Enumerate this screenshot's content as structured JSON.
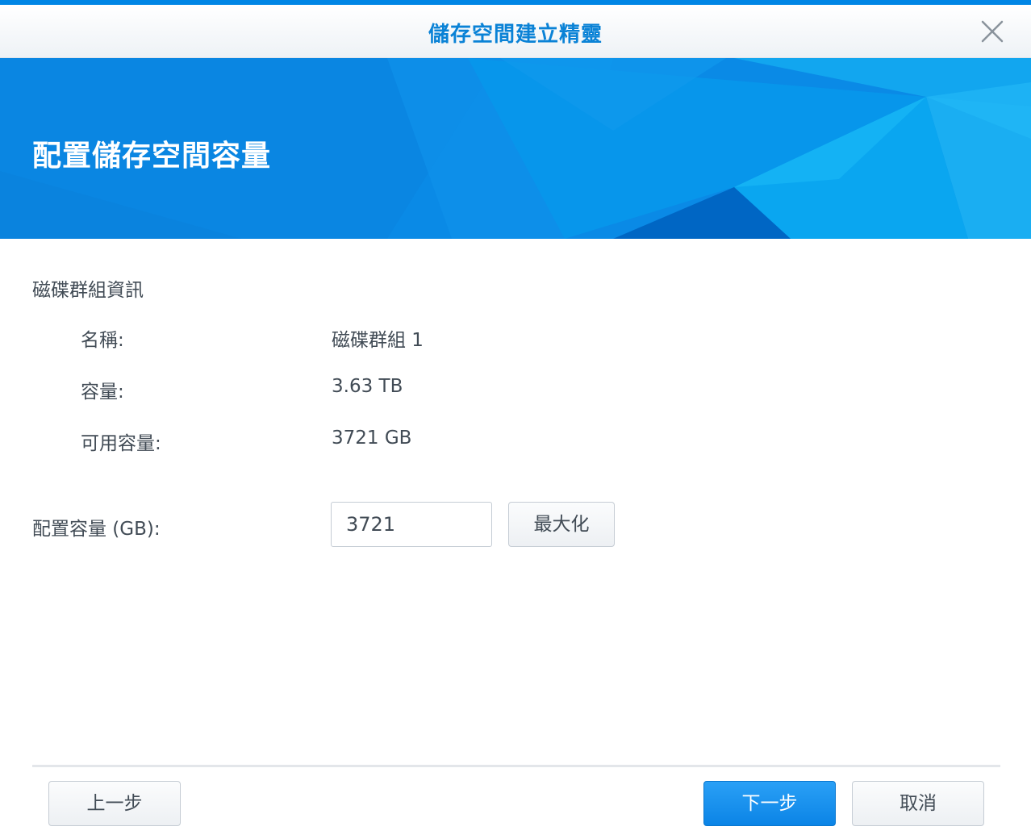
{
  "window": {
    "title": "儲存空間建立精靈"
  },
  "banner": {
    "title": "配置儲存空間容量"
  },
  "disk_group_info": {
    "section_title": "磁碟群組資訊",
    "rows": [
      {
        "label": "名稱:",
        "value": "磁碟群組 1"
      },
      {
        "label": "容量:",
        "value": "3.63 TB"
      },
      {
        "label": "可用容量:",
        "value": "3721 GB"
      }
    ]
  },
  "allocation": {
    "label": "配置容量 (GB):",
    "value": "3721",
    "maximize_label": "最大化"
  },
  "footer": {
    "back_label": "上一步",
    "next_label": "下一步",
    "cancel_label": "取消"
  },
  "icons": {
    "close": "close-icon"
  },
  "colors": {
    "accent": "#0086e5",
    "title_text": "#0a82d6",
    "banner": "#0a8ae6",
    "primary_button": "#0b84e6",
    "body_text": "#414b55"
  }
}
